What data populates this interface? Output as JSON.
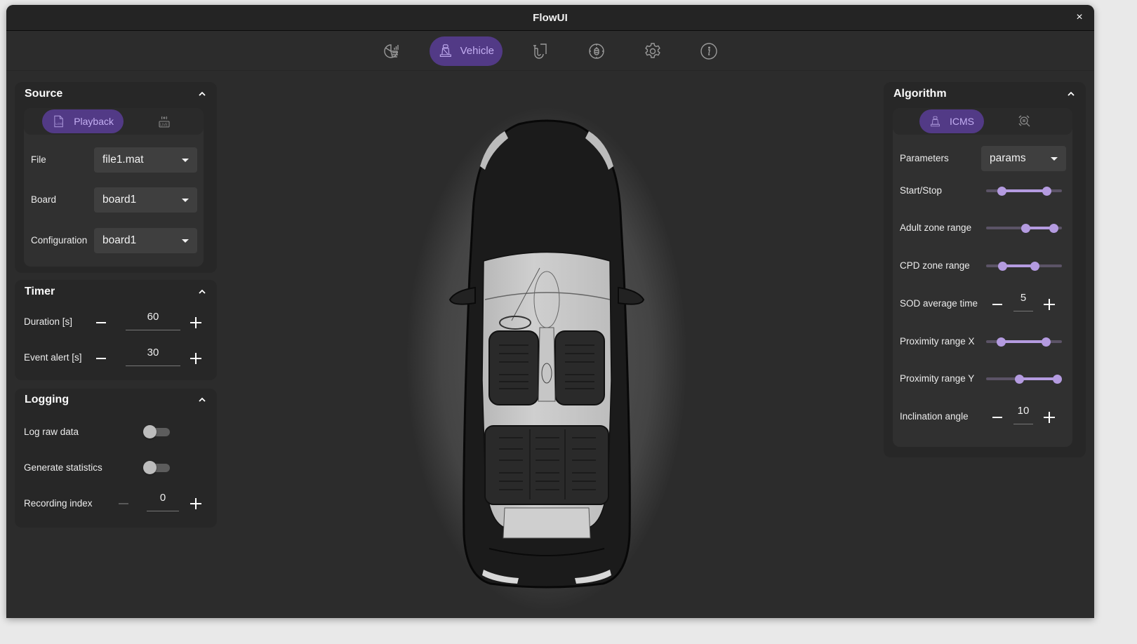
{
  "window": {
    "title": "FlowUI",
    "close_label": "×"
  },
  "navbar": {
    "items": [
      {
        "icon": "analytics-icon",
        "label": "",
        "active": false
      },
      {
        "icon": "seat-icon",
        "label": "Vehicle",
        "active": true
      },
      {
        "icon": "pipeline-icon",
        "label": "",
        "active": false
      },
      {
        "icon": "debug-icon",
        "label": "",
        "active": false
      },
      {
        "icon": "gear-icon",
        "label": "",
        "active": false
      },
      {
        "icon": "info-icon",
        "label": "",
        "active": false
      }
    ]
  },
  "source": {
    "title": "Source",
    "modes": [
      {
        "icon": "log-file-icon",
        "label": "Playback",
        "active": true
      },
      {
        "icon": "live-icon",
        "label": "",
        "active": false
      }
    ],
    "fields": [
      {
        "label": "File",
        "value": "file1.mat"
      },
      {
        "label": "Board",
        "value": "board1"
      },
      {
        "label": "Configuration",
        "value": "board1"
      }
    ]
  },
  "timer": {
    "title": "Timer",
    "fields": [
      {
        "label": "Duration [s]",
        "value": "60"
      },
      {
        "label": "Event alert [s]",
        "value": "30"
      }
    ]
  },
  "logging": {
    "title": "Logging",
    "toggles": [
      {
        "label": "Log raw data",
        "on": false
      },
      {
        "label": "Generate statistics",
        "on": false
      }
    ],
    "recording": {
      "label": "Recording index",
      "value": "0",
      "decrement_disabled": true
    }
  },
  "algorithm": {
    "title": "Algorithm",
    "modes": [
      {
        "icon": "seat-icon",
        "label": "ICMS",
        "active": true
      },
      {
        "icon": "radar-search-icon",
        "label": "",
        "active": false
      }
    ],
    "parameters": {
      "label": "Parameters",
      "value": "params"
    },
    "controls": [
      {
        "type": "range",
        "label": "Start/Stop",
        "low": 0.21,
        "high": 0.8
      },
      {
        "type": "range",
        "label": "Adult zone range",
        "low": 0.52,
        "high": 0.89
      },
      {
        "type": "range",
        "label": "CPD zone range",
        "low": 0.22,
        "high": 0.64
      },
      {
        "type": "stepper",
        "label": "SOD average time",
        "value": "5"
      },
      {
        "type": "range",
        "label": "Proximity range X",
        "low": 0.2,
        "high": 0.79
      },
      {
        "type": "range",
        "label": "Proximity range Y",
        "low": 0.44,
        "high": 0.94
      },
      {
        "type": "stepper",
        "label": "Inclination angle",
        "value": "10"
      }
    ]
  },
  "colors": {
    "accent": "#523a86",
    "accent_text": "#c3aef2",
    "slider": "#b49be0",
    "background": "#2c2c2c",
    "panel": "#272727"
  }
}
